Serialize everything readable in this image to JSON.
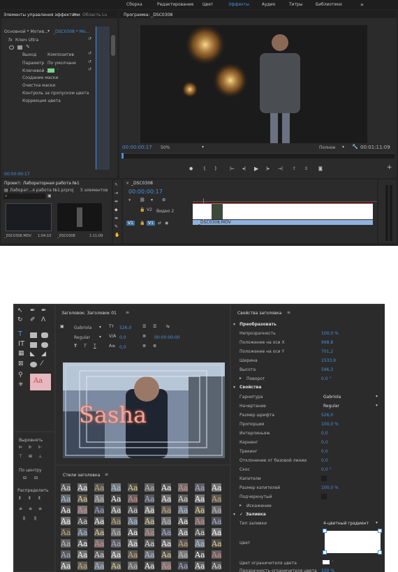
{
  "top": {
    "workspaces": [
      "Сборка",
      "Редактирование",
      "Цвет",
      "Эффекты",
      "Аудио",
      "Титры",
      "Библиотеки"
    ],
    "more": "»"
  },
  "effects": {
    "tab1": "Элементы управления эффектами",
    "tab2": "Область Lu",
    "menu_icon": "≡",
    "clip_source": "Основной * Мотив...",
    "clip_target": "_DSC0308 * Мо...",
    "fx_name": "Ключ Ultra",
    "output_label": "Выход",
    "output_value": "Композитив",
    "param_label": "Параметр",
    "param_value": "По умолчани",
    "key_color_label": "Ключевой ...",
    "sections": [
      "Создание маски",
      "Очистка маски",
      "Контроль за пропуском цвета",
      "Коррекция цвета"
    ],
    "timecode": "00:00:00:17"
  },
  "program": {
    "title": "Программа: _DSC0308",
    "timecode": "00:00:00:17",
    "zoom": "50%",
    "quality": "Полное",
    "duration": "00:01:11:09"
  },
  "project": {
    "title": "Проект: Лабораторная работа №1",
    "file": "Лаборат...я работа №1.prproj",
    "count": "5 элементов",
    "clip1_name": "_DSC0308.MOV",
    "clip1_dur": "1:04:10",
    "clip2_name": "_DSC0308",
    "clip2_dur": "1:11:09"
  },
  "timeline": {
    "tab": "_DSC0308",
    "timecode": "00:00:00:17",
    "track_v2": "V2",
    "track_label": "Видео 2",
    "track_v1": "V1",
    "clip_name": "_DSC0308.MOV"
  },
  "titler": {
    "title": "Заголовок: Заголовок 01",
    "menu_icon": "≡",
    "font": "Gabriola",
    "style": "Regular",
    "size": "526,0",
    "kerning": "0,0",
    "leading": "0,0",
    "tab_stop": "00:00:00:00",
    "preview_text": "Sasha",
    "align_heading": "Выровнять",
    "center_heading": "По центру",
    "distribute_heading": "Распределить",
    "styles_heading": "Стили заголовка",
    "swatch_text": "Aa",
    "tool_swatch": "Aa"
  },
  "props": {
    "title": "Свойства заголовка",
    "menu_icon": "≡",
    "transform": "Преобразовать",
    "opacity_label": "Непрозрачность",
    "opacity": "100,0 %",
    "posx_label": "Положение на оси X",
    "posx": "968,8",
    "posy_label": "Положение на оси Y",
    "posy": "701,2",
    "width_label": "Ширина",
    "width": "1533,9",
    "height_label": "Высота",
    "height": "596,3",
    "rotation_label": "Поворот",
    "rotation": "0,0 °",
    "properties": "Свойства",
    "font_label": "Гарнитура",
    "font": "Gabriola",
    "style_label": "Начертание",
    "style": "Regular",
    "size_label": "Размер шрифта",
    "size": "526,0",
    "aspect_label": "Пропорции",
    "aspect": "100,0 %",
    "leading_label": "Интерлиньяж",
    "leading": "0,0",
    "kerning_label": "Кернинг",
    "kerning": "0,0",
    "tracking_label": "Трекинг",
    "tracking": "0,0",
    "baseline_label": "Отклонение от базовой линии",
    "baseline": "0,0",
    "slant_label": "Скос",
    "slant": "0,0 °",
    "caps_label": "Капители",
    "capsize_label": "Размер капителей",
    "capsize": "100,0 %",
    "underline_label": "Подчеркнутый",
    "distort": "Искажение",
    "fill": "Заливка",
    "fill_type_label": "Тип заливки",
    "fill_type": "4-цветный градиент",
    "color_label": "Цвет",
    "stop_color_label": "Цвет ограничителя цвета",
    "stop_opacity_label": "Прозрачность ограничителя цвета",
    "stop_opacity": "100 %"
  }
}
